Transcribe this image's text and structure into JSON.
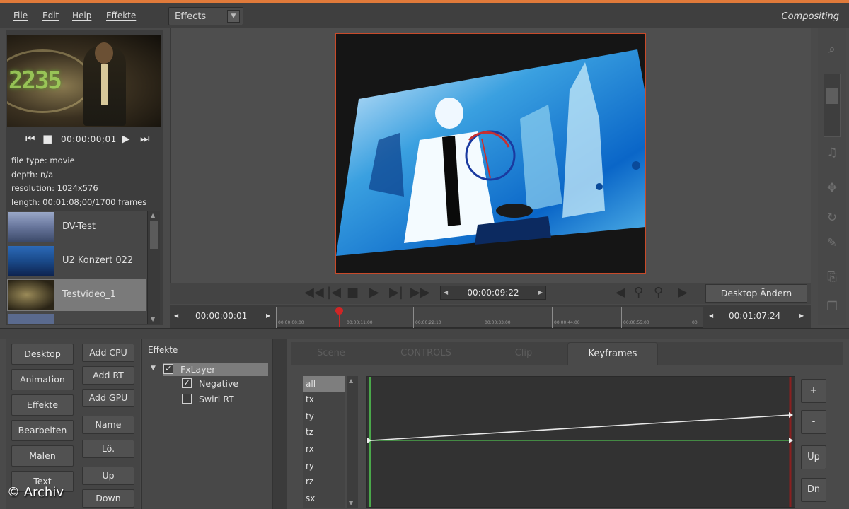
{
  "menu": {
    "items": [
      "File",
      "Edit",
      "Help",
      "Effekte"
    ]
  },
  "effects_select": {
    "value": "Effects"
  },
  "mode": "Compositing",
  "preview": {
    "time": "00:00:00;01",
    "info": [
      "file type: movie",
      "depth: n/a",
      "resolution: 1024x576",
      "length: 00:01:08;00/1700 frames"
    ]
  },
  "clips": [
    {
      "label": "DV-Test",
      "selected": false
    },
    {
      "label": "U2 Konzert 022",
      "selected": false
    },
    {
      "label": "Testvideo_1",
      "selected": true
    }
  ],
  "transport": {
    "time": "00:00:09:22",
    "desktop_button": "Desktop Ändern"
  },
  "timeline": {
    "start": "00:00:00:01",
    "end": "00:01:07:24",
    "ticks": [
      "00:00:00:00",
      "00:00:11:00",
      "00:00:22:10",
      "00:00:33:00",
      "00:00:44:00",
      "00:00:55:00",
      "00:"
    ]
  },
  "buttons": {
    "left": [
      "Desktop",
      "Animation",
      "Effekte",
      "Bearbeiten",
      "Malen",
      "Text"
    ],
    "right": [
      "Add CPU",
      "Add RT",
      "Add GPU",
      "Name",
      "Lö.",
      "Up",
      "Down"
    ]
  },
  "effects_tree": {
    "title": "Effekte",
    "items": [
      {
        "label": "FxLayer",
        "checked": true,
        "level": 0,
        "selected": true
      },
      {
        "label": "Negative",
        "checked": true,
        "level": 1,
        "selected": false
      },
      {
        "label": "Swirl RT",
        "checked": false,
        "level": 1,
        "selected": false
      }
    ]
  },
  "keyframes": {
    "tabs": [
      "Scene",
      "CONTROLS",
      "Clip",
      "Keyframes"
    ],
    "active_tab": "Keyframes",
    "params": [
      "all",
      "tx",
      "ty",
      "tz",
      "rx",
      "ry",
      "rz",
      "sx"
    ],
    "selected_param": "all",
    "side_buttons": [
      "+",
      "-",
      "Up",
      "Dn"
    ]
  },
  "copyright": "© Archiv",
  "colors": {
    "accent": "#e07a3a",
    "frame_border": "#c84a2a",
    "playhead": "#d02525",
    "curve_green": "#4aa84a"
  }
}
